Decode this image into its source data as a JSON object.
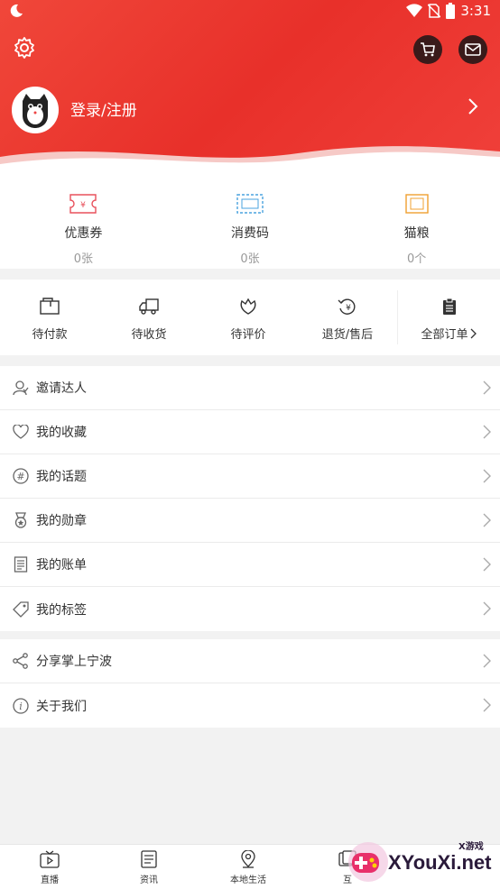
{
  "status_bar": {
    "time": "3:31"
  },
  "header": {
    "login_label": "登录/注册"
  },
  "wallet": [
    {
      "name": "优惠券",
      "count": "0张",
      "icon": "coupon-icon",
      "color": "#e8505b"
    },
    {
      "name": "消费码",
      "count": "0张",
      "icon": "consume-code-icon",
      "color": "#4aa3df"
    },
    {
      "name": "猫粮",
      "count": "0个",
      "icon": "cat-food-icon",
      "color": "#f0a030"
    }
  ],
  "orders": [
    {
      "name": "待付款",
      "icon": "wallet-icon"
    },
    {
      "name": "待收货",
      "icon": "truck-icon"
    },
    {
      "name": "待评价",
      "icon": "rate-icon"
    },
    {
      "name": "退货/售后",
      "icon": "refund-icon"
    },
    {
      "name": "全部订单",
      "icon": "clipboard-icon"
    }
  ],
  "menu1": [
    {
      "label": "邀请达人",
      "icon": "invite-user-icon"
    },
    {
      "label": "我的收藏",
      "icon": "heart-icon"
    },
    {
      "label": "我的话题",
      "icon": "hashtag-icon"
    },
    {
      "label": "我的勋章",
      "icon": "medal-icon"
    },
    {
      "label": "我的账单",
      "icon": "bill-icon"
    },
    {
      "label": "我的标签",
      "icon": "tag-icon"
    }
  ],
  "menu2": [
    {
      "label": "分享掌上宁波",
      "icon": "share-icon"
    },
    {
      "label": "关于我们",
      "icon": "info-icon"
    }
  ],
  "bottom_nav": [
    {
      "name": "直播",
      "icon": "tv-icon"
    },
    {
      "name": "资讯",
      "icon": "news-icon"
    },
    {
      "name": "本地生活",
      "icon": "location-icon"
    },
    {
      "name": "互",
      "icon": "interact-icon"
    }
  ],
  "watermark": {
    "text": "XYouXi.net",
    "small": "X游戏"
  },
  "colors": {
    "header_red": "#e8302a",
    "text": "#333333",
    "muted": "#999999"
  }
}
